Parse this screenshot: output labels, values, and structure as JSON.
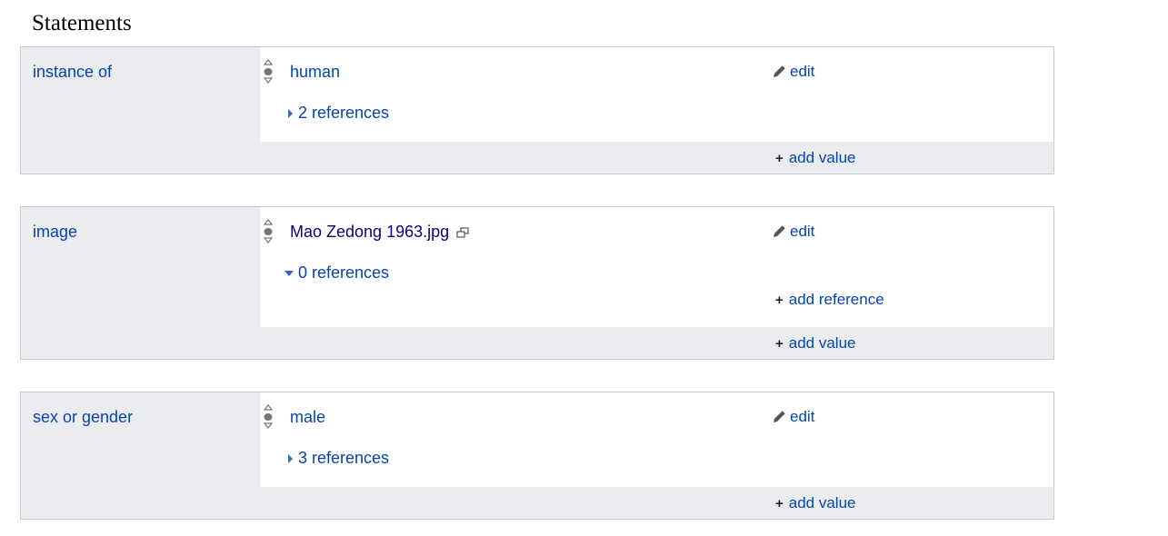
{
  "section": {
    "title": "Statements"
  },
  "statements": [
    {
      "property": "instance of",
      "value": "human",
      "edit_label": "edit",
      "references_label": "2 references",
      "add_value_label": "add value"
    },
    {
      "property": "image",
      "value": "Mao Zedong 1963.jpg",
      "edit_label": "edit",
      "references_label": "0 references",
      "add_reference_label": "add reference",
      "add_value_label": "add value"
    },
    {
      "property": "sex or gender",
      "value": "male",
      "edit_label": "edit",
      "references_label": "3 references",
      "add_value_label": "add value"
    }
  ],
  "icons": {
    "rank": "rank-selector-icon",
    "edit": "pencil-icon",
    "external": "external-link-icon",
    "expand": "triangle-right-icon",
    "collapse": "triangle-down-icon",
    "add": "plus-icon"
  },
  "colors": {
    "link": "#0645ad",
    "file_link": "#0b0080",
    "panel": "#eaecf0",
    "border": "#c8ccd1"
  }
}
